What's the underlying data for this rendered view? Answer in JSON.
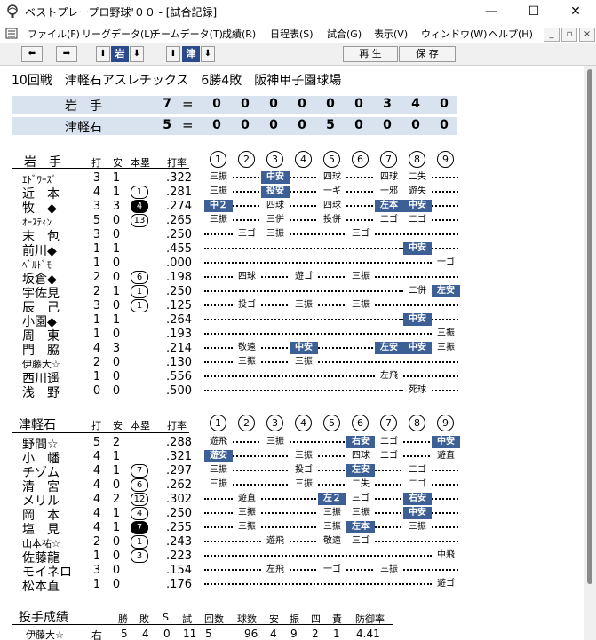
{
  "window": {
    "title": "ベストプレープロ野球'００ - [試合記録]",
    "controls": {
      "minimize": "—",
      "maximize": "☐",
      "close": "✕"
    }
  },
  "menu": [
    "ファイル(F)",
    "リーグデータ(L)",
    "チームデータ(T)",
    "成績(R)",
    "日程表(S)",
    "試合(G)",
    "表示(V)",
    "ウィンドウ(W)",
    "ヘルプ(H)"
  ],
  "mdi": {
    "min": "_",
    "restore": "▫",
    "close": "×"
  },
  "toolbar": {
    "prev": "⬅",
    "next": "➡",
    "up1": "⬆",
    "team1": "岩",
    "down1": "⬇",
    "up2": "⬆",
    "team2": "津",
    "down2": "⬇",
    "replay": "再 生",
    "save": "保 存"
  },
  "game": {
    "info": "10回戦　津軽石アスレチックス　6勝4敗　阪神甲子園球場",
    "score": [
      {
        "team": "岩　手",
        "total": "7",
        "eq": "=",
        "innings": [
          "0",
          "0",
          "0",
          "0",
          "0",
          "0",
          "3",
          "4",
          "0"
        ]
      },
      {
        "team": "津軽石",
        "total": "5",
        "eq": "=",
        "innings": [
          "0",
          "0",
          "0",
          "0",
          "5",
          "0",
          "0",
          "0",
          "0"
        ]
      }
    ]
  },
  "headers": {
    "ab": "打",
    "hit": "安",
    "hr": "本塁",
    "avg": "打率",
    "innings": [
      "1",
      "2",
      "3",
      "4",
      "5",
      "6",
      "7",
      "8",
      "9"
    ]
  },
  "teams": [
    {
      "name": "岩　手",
      "players": [
        {
          "name": "ｴﾄﾞﾜｰｽﾞ",
          "small": true,
          "ab": "3",
          "h": "1",
          "hr": "",
          "avg": ".322",
          "abs": [
            [
              "三振",
              1,
              false
            ],
            [
              "中安",
              3,
              true
            ],
            [
              "四球",
              5,
              false
            ],
            [
              "四球",
              7,
              false
            ],
            [
              "二失",
              8,
              false
            ]
          ]
        },
        {
          "name": "近　本",
          "ab": "4",
          "h": "1",
          "hr": "1",
          "avg": ".281",
          "abs": [
            [
              "三振",
              1,
              false
            ],
            [
              "投安",
              3,
              true
            ],
            [
              "一ギ",
              5,
              false
            ],
            [
              "一邪",
              7,
              false
            ],
            [
              "遊失",
              8,
              false
            ]
          ]
        },
        {
          "name": "牧　◆",
          "ab": "3",
          "h": "3",
          "hr": "4",
          "hrFilled": true,
          "avg": ".274",
          "abs": [
            [
              "中２",
              1,
              true
            ],
            [
              "四球",
              3,
              false
            ],
            [
              "四球",
              5,
              false
            ],
            [
              "左本",
              7,
              true
            ],
            [
              "中安",
              8,
              true
            ]
          ]
        },
        {
          "name": "ｵｰｽﾃｨﾝ",
          "small": true,
          "ab": "5",
          "h": "0",
          "hr": "13",
          "avg": ".265",
          "abs": [
            [
              "三振",
              1,
              false
            ],
            [
              "三併",
              3,
              false
            ],
            [
              "投併",
              5,
              false
            ],
            [
              "二ゴ",
              7,
              false
            ],
            [
              "二ゴ",
              8,
              false
            ]
          ]
        },
        {
          "name": "末　包",
          "ab": "3",
          "h": "0",
          "hr": "",
          "avg": ".250",
          "abs": [
            [
              "三ゴ",
              2,
              false
            ],
            [
              "三振",
              3,
              false
            ],
            [
              "三ゴ",
              6,
              false
            ]
          ]
        },
        {
          "name": "前川◆",
          "ab": "1",
          "h": "1",
          "hr": "",
          "avg": ".455",
          "abs": [
            [
              "中安",
              8,
              true
            ]
          ]
        },
        {
          "name": "ﾍﾞﾙﾄﾞﾓ",
          "small": true,
          "ab": "1",
          "h": "0",
          "hr": "",
          "avg": ".000",
          "abs": [
            [
              "一ゴ",
              9,
              false
            ]
          ]
        },
        {
          "name": "坂倉◆",
          "ab": "2",
          "h": "0",
          "hr": "6",
          "avg": ".198",
          "abs": [
            [
              "四球",
              2,
              false
            ],
            [
              "遊ゴ",
              4,
              false
            ],
            [
              "三振",
              6,
              false
            ]
          ]
        },
        {
          "name": "宇佐見",
          "ab": "2",
          "h": "1",
          "hr": "1",
          "avg": ".250",
          "abs": [
            [
              "二併",
              8,
              false
            ],
            [
              "左安",
              9,
              true
            ]
          ]
        },
        {
          "name": "辰　己",
          "ab": "3",
          "h": "0",
          "hr": "1",
          "avg": ".125",
          "abs": [
            [
              "投ゴ",
              2,
              false
            ],
            [
              "三振",
              4,
              false
            ],
            [
              "三振",
              6,
              false
            ]
          ]
        },
        {
          "name": "小園◆",
          "ab": "1",
          "h": "1",
          "hr": "",
          "avg": ".264",
          "abs": [
            [
              "中安",
              8,
              true
            ]
          ]
        },
        {
          "name": "周　東",
          "ab": "1",
          "h": "0",
          "hr": "",
          "avg": ".193",
          "abs": [
            [
              "三振",
              9,
              false
            ]
          ]
        },
        {
          "name": "門　脇",
          "ab": "4",
          "h": "3",
          "hr": "",
          "avg": ".214",
          "abs": [
            [
              "敬遠",
              2,
              false
            ],
            [
              "中安",
              4,
              true
            ],
            [
              "左安",
              7,
              true
            ],
            [
              "中安",
              8,
              true
            ],
            [
              "三振",
              9,
              false
            ]
          ]
        },
        {
          "name": "伊藤大☆",
          "small": true,
          "ab": "2",
          "h": "0",
          "hr": "",
          "avg": ".130",
          "abs": [
            [
              "三振",
              2,
              false
            ],
            [
              "三振",
              4,
              false
            ]
          ]
        },
        {
          "name": "西川遥",
          "ab": "1",
          "h": "0",
          "hr": "",
          "avg": ".556",
          "abs": [
            [
              "左飛",
              7,
              false
            ]
          ]
        },
        {
          "name": "浅　野",
          "ab": "0",
          "h": "0",
          "hr": "",
          "avg": ".500",
          "abs": [
            [
              "死球",
              8,
              false
            ]
          ]
        }
      ]
    },
    {
      "name": "津軽石",
      "players": [
        {
          "name": "野間☆",
          "ab": "5",
          "h": "2",
          "hr": "",
          "avg": ".288",
          "abs": [
            [
              "遊飛",
              1,
              false
            ],
            [
              "三振",
              3,
              false
            ],
            [
              "右安",
              6,
              true
            ],
            [
              "二ゴ",
              7,
              false
            ],
            [
              "中安",
              9,
              true
            ]
          ]
        },
        {
          "name": "小　幡",
          "ab": "4",
          "h": "1",
          "hr": "",
          "avg": ".321",
          "abs": [
            [
              "遊安",
              1,
              true
            ],
            [
              "三振",
              4,
              false
            ],
            [
              "四球",
              6,
              false
            ],
            [
              "二ゴ",
              7,
              false
            ],
            [
              "遊直",
              9,
              false
            ]
          ]
        },
        {
          "name": "チゾム",
          "ab": "4",
          "h": "1",
          "hr": "7",
          "avg": ".297",
          "abs": [
            [
              "三振",
              1,
              false
            ],
            [
              "投ゴ",
              4,
              false
            ],
            [
              "左安",
              6,
              true
            ],
            [
              "二ゴ",
              8,
              false
            ]
          ]
        },
        {
          "name": "清　宮",
          "ab": "4",
          "h": "0",
          "hr": "6",
          "avg": ".262",
          "abs": [
            [
              "三振",
              1,
              false
            ],
            [
              "三振",
              4,
              false
            ],
            [
              "二失",
              6,
              false
            ],
            [
              "二ゴ",
              8,
              false
            ]
          ]
        },
        {
          "name": "メリル",
          "ab": "4",
          "h": "2",
          "hr": "12",
          "avg": ".302",
          "abs": [
            [
              "遊直",
              2,
              false
            ],
            [
              "左２",
              5,
              true
            ],
            [
              "三ゴ",
              6,
              false
            ],
            [
              "右安",
              8,
              true
            ]
          ]
        },
        {
          "name": "岡　本",
          "ab": "4",
          "h": "1",
          "hr": "4",
          "avg": ".250",
          "abs": [
            [
              "三振",
              2,
              false
            ],
            [
              "三振",
              5,
              false
            ],
            [
              "三振",
              6,
              false
            ],
            [
              "中安",
              8,
              true
            ]
          ]
        },
        {
          "name": "塩　見",
          "ab": "4",
          "h": "1",
          "hr": "7",
          "hrFilled": true,
          "avg": ".255",
          "abs": [
            [
              "三振",
              2,
              false
            ],
            [
              "三振",
              5,
              false
            ],
            [
              "左本",
              6,
              true
            ],
            [
              "三振",
              8,
              false
            ]
          ]
        },
        {
          "name": "山本祐☆",
          "small": true,
          "ab": "2",
          "h": "0",
          "hr": "1",
          "avg": ".243",
          "abs": [
            [
              "遊飛",
              3,
              false
            ],
            [
              "敬遠",
              5,
              false
            ],
            [
              "三ゴ",
              6,
              false
            ]
          ]
        },
        {
          "name": "佐藤龍",
          "ab": "1",
          "h": "0",
          "hr": "3",
          "avg": ".223",
          "abs": [
            [
              "中飛",
              9,
              false
            ]
          ]
        },
        {
          "name": "モイネロ",
          "ab": "3",
          "h": "0",
          "hr": "",
          "avg": ".154",
          "abs": [
            [
              "左飛",
              3,
              false
            ],
            [
              "一ゴ",
              5,
              false
            ],
            [
              "三振",
              7,
              false
            ]
          ]
        },
        {
          "name": "松本直",
          "ab": "1",
          "h": "0",
          "hr": "",
          "avg": ".176",
          "abs": [
            [
              "遊ゴ",
              9,
              false
            ]
          ]
        }
      ]
    }
  ],
  "pitching": {
    "title": "投手成績",
    "headers": [
      "勝",
      "敗",
      "S",
      "試",
      "回数",
      "球数",
      "安",
      "振",
      "四",
      "責",
      "防御率"
    ],
    "rows": [
      {
        "name": "伊藤大☆",
        "hand": "右",
        "vals": [
          "5",
          "4",
          "0",
          "11",
          "5",
          "96",
          "4",
          "9",
          "2",
          "1",
          "4.41"
        ]
      }
    ]
  }
}
